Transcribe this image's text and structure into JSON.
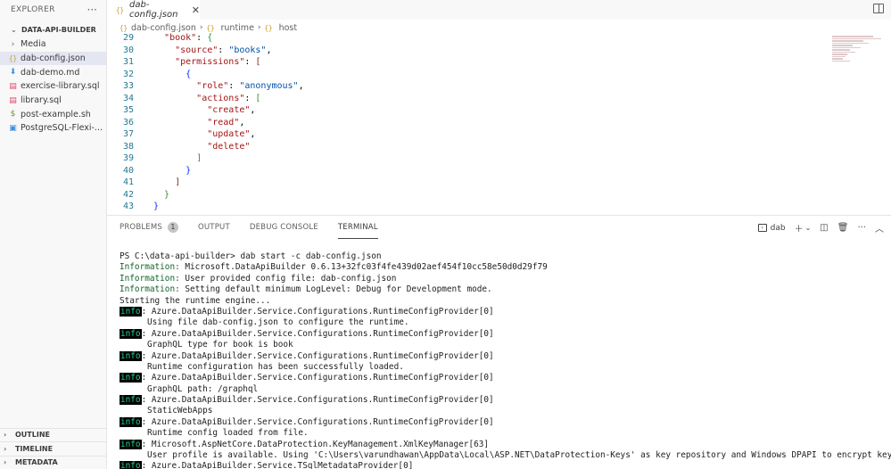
{
  "sidebar": {
    "explorer_label": "EXPLORER",
    "more": "···",
    "project": "DATA-API-BUILDER",
    "items": [
      {
        "label": "Media",
        "icon": "folder-chevron-icon"
      },
      {
        "label": "dab-config.json",
        "icon": "json-file-icon"
      },
      {
        "label": "dab-demo.md",
        "icon": "markdown-file-icon"
      },
      {
        "label": "exercise-library.sql",
        "icon": "sql-file-icon"
      },
      {
        "label": "library.sql",
        "icon": "sql-file-icon"
      },
      {
        "label": "post-example.sh",
        "icon": "shell-file-icon"
      },
      {
        "label": "PostgreSQL-Flexi-App...",
        "icon": "postgres-file-icon"
      }
    ],
    "bottom": [
      "OUTLINE",
      "TIMELINE",
      "METADATA"
    ]
  },
  "editor": {
    "tab_label": "dab-config.json",
    "breadcrumb": [
      "dab-config.json",
      "runtime",
      "host"
    ],
    "lines": [
      {
        "n": "29"
      },
      {
        "n": "30"
      },
      {
        "n": "31"
      },
      {
        "n": "32"
      },
      {
        "n": "33"
      },
      {
        "n": "34"
      },
      {
        "n": "35"
      },
      {
        "n": "36"
      },
      {
        "n": "37"
      },
      {
        "n": "38"
      },
      {
        "n": "39"
      },
      {
        "n": "40"
      },
      {
        "n": "41"
      },
      {
        "n": "42"
      },
      {
        "n": "43"
      }
    ],
    "tokens": {
      "book": "\"book\"",
      "source_key": "\"source\"",
      "source_val": "\"books\"",
      "permissions": "\"permissions\"",
      "role_key": "\"role\"",
      "role_val": "\"anonymous\"",
      "actions": "\"actions\"",
      "create": "\"create\"",
      "read": "\"read\"",
      "update": "\"update\"",
      "delete": "\"delete\""
    }
  },
  "panel": {
    "tabs": [
      "PROBLEMS",
      "OUTPUT",
      "DEBUG CONSOLE",
      "TERMINAL"
    ],
    "problems_count": "1",
    "terminal_name": "dab",
    "terminal_lines": {
      "prompt": "PS C:\\data-api-builder> dab start -c dab-config.json",
      "i1_label": "Information:",
      "i1_text": " Microsoft.DataApiBuilder 0.6.13+32fc03f4fe439d02aef454f10cc58e50d0d29f79",
      "i2_label": "Information:",
      "i2_text": " User provided config file: dab-config.json",
      "i3_label": "Information:",
      "i3_text": " Setting default minimum LogLevel: Debug for Development mode.",
      "starting": "Starting the runtime engine...",
      "info": "info",
      "rcp": ": Azure.DataApiBuilder.Service.Configurations.RuntimeConfigProvider[0]",
      "msg1": "Using file dab-config.json to configure the runtime.",
      "msg2": "GraphQL type for book is book",
      "msg3": "Runtime configuration has been successfully loaded.",
      "msg4": "GraphQL path: /graphql",
      "msg5": "StaticWebApps",
      "msg6": "Runtime config loaded from file.",
      "km": ": Microsoft.AspNetCore.DataProtection.KeyManagement.XmlKeyManager[63]",
      "msg7": "User profile is available. Using 'C:\\Users\\varundhawan\\AppData\\Local\\ASP.NET\\DataProtection-Keys' as key repository and Windows DPAPI to encrypt keys at rest.",
      "last": ": Azure.DataApiBuilder.Service.TSqlMetadataProvider[0]"
    }
  }
}
